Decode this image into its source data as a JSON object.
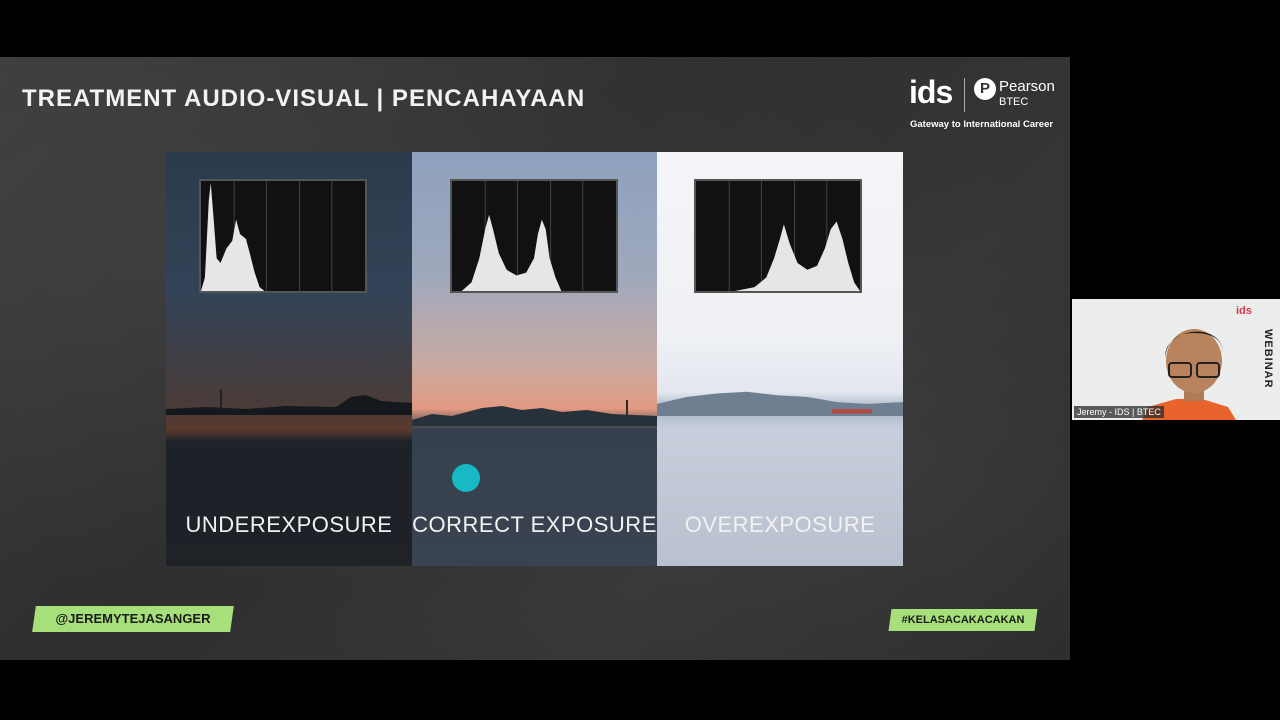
{
  "slide": {
    "title": "TREATMENT AUDIO-VISUAL | PENCAHAYAAN",
    "logo": {
      "ids": "ids",
      "pearson": "Pearson",
      "btec": "BTEC",
      "tagline": "Gateway to International Career"
    },
    "panels": [
      {
        "caption": "UNDEREXPOSURE"
      },
      {
        "caption": "CORRECT EXPOSURE"
      },
      {
        "caption": "OVEREXPOSURE"
      }
    ],
    "handle_left": "@JEREMYTEJASANGER",
    "handle_right": "#KELASACAKACAKAN"
  },
  "video": {
    "name_tag": "Jeremy - IDS | BTEC",
    "logo_text": "ids",
    "side_text": "WEBINAR"
  },
  "colors": {
    "accent_green": "#a7e07a",
    "cursor_teal": "#17b9c5",
    "shirt_orange": "#e8642c"
  }
}
